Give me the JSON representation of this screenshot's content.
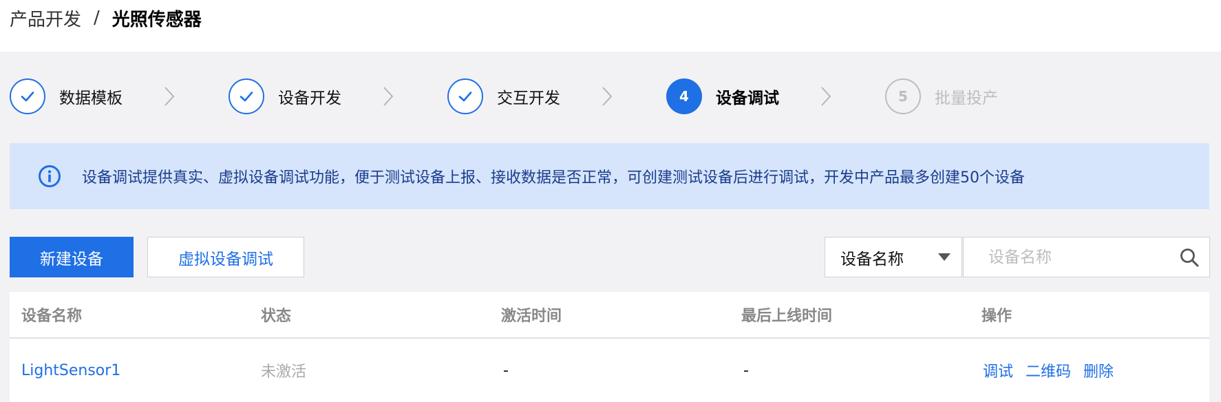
{
  "breadcrumb": {
    "parent": "产品开发",
    "separator": "/",
    "current": "光照传感器"
  },
  "steps": [
    {
      "label": "数据模板",
      "state": "done",
      "marker": "check-icon"
    },
    {
      "label": "设备开发",
      "state": "done",
      "marker": "check-icon"
    },
    {
      "label": "交互开发",
      "state": "done",
      "marker": "check-icon"
    },
    {
      "label": "设备调试",
      "state": "active",
      "number": "4"
    },
    {
      "label": "批量投产",
      "state": "todo",
      "number": "5"
    }
  ],
  "alert": {
    "icon": "info-icon",
    "message": "设备调试提供真实、虚拟设备调试功能，便于测试设备上报、接收数据是否正常，可创建测试设备后进行调试，开发中产品最多创建50个设备"
  },
  "toolbar": {
    "create_label": "新建设备",
    "virtual_debug_label": "虚拟设备调试",
    "filter_selected": "设备名称",
    "search_placeholder": "设备名称"
  },
  "table": {
    "headers": [
      "设备名称",
      "状态",
      "激活时间",
      "最后上线时间",
      "操作"
    ],
    "rows": [
      {
        "name": "LightSensor1",
        "status": "未激活",
        "activated_at": "-",
        "last_online": "-",
        "actions": [
          "调试",
          "二维码",
          "删除"
        ]
      }
    ]
  },
  "colors": {
    "accent": "#1f6fe5",
    "page_bg": "#f2f2f5",
    "alert_bg": "#d6e5fb",
    "alert_text": "#1c3c8c",
    "muted": "#bdbdbd"
  }
}
